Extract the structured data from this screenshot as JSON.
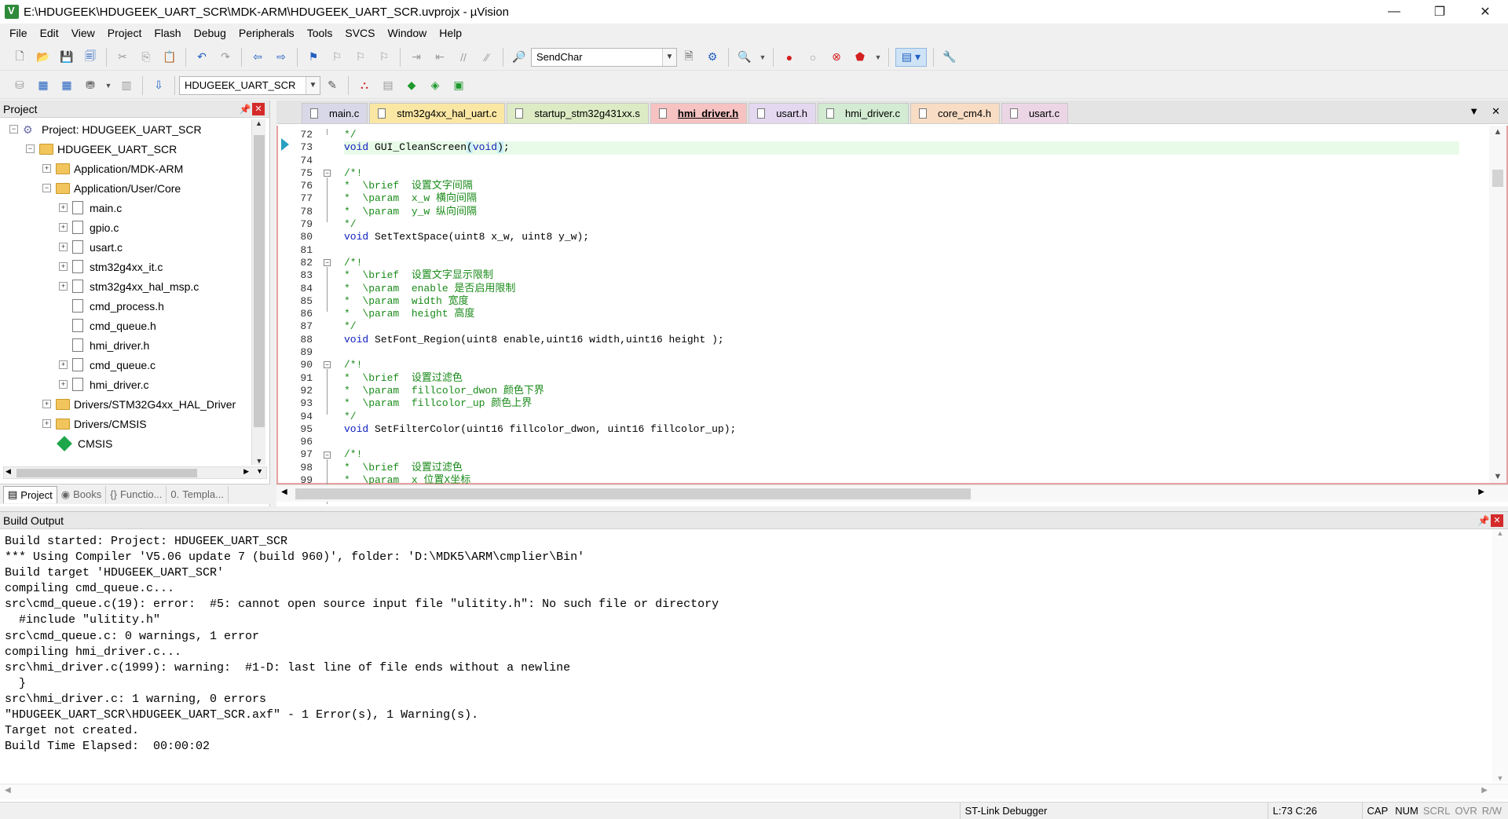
{
  "window": {
    "title": "E:\\HDUGEEK\\HDUGEEK_UART_SCR\\MDK-ARM\\HDUGEEK_UART_SCR.uvprojx - µVision",
    "minimize": "—",
    "restore": "❐",
    "close": "✕"
  },
  "menu": [
    "File",
    "Edit",
    "View",
    "Project",
    "Flash",
    "Debug",
    "Peripherals",
    "Tools",
    "SVCS",
    "Window",
    "Help"
  ],
  "toolbar": {
    "find_combo": "SendChar",
    "target_combo": "HDUGEEK_UART_SCR"
  },
  "project_panel": {
    "title": "Project",
    "tree": [
      {
        "label": "Project: HDUGEEK_UART_SCR",
        "depth": 0,
        "kind": "project",
        "expander": "−"
      },
      {
        "label": "HDUGEEK_UART_SCR",
        "depth": 1,
        "kind": "target",
        "expander": "−"
      },
      {
        "label": "Application/MDK-ARM",
        "depth": 2,
        "kind": "folder",
        "expander": "+"
      },
      {
        "label": "Application/User/Core",
        "depth": 2,
        "kind": "folder",
        "expander": "−"
      },
      {
        "label": "main.c",
        "depth": 3,
        "kind": "file",
        "expander": "+"
      },
      {
        "label": "gpio.c",
        "depth": 3,
        "kind": "file",
        "expander": "+"
      },
      {
        "label": "usart.c",
        "depth": 3,
        "kind": "file",
        "expander": "+"
      },
      {
        "label": "stm32g4xx_it.c",
        "depth": 3,
        "kind": "file",
        "expander": "+"
      },
      {
        "label": "stm32g4xx_hal_msp.c",
        "depth": 3,
        "kind": "file",
        "expander": "+"
      },
      {
        "label": "cmd_process.h",
        "depth": 3,
        "kind": "file",
        "expander": ""
      },
      {
        "label": "cmd_queue.h",
        "depth": 3,
        "kind": "file",
        "expander": ""
      },
      {
        "label": "hmi_driver.h",
        "depth": 3,
        "kind": "file",
        "expander": ""
      },
      {
        "label": "cmd_queue.c",
        "depth": 3,
        "kind": "file",
        "expander": "+"
      },
      {
        "label": "hmi_driver.c",
        "depth": 3,
        "kind": "file",
        "expander": "+"
      },
      {
        "label": "Drivers/STM32G4xx_HAL_Driver",
        "depth": 2,
        "kind": "folder",
        "expander": "+"
      },
      {
        "label": "Drivers/CMSIS",
        "depth": 2,
        "kind": "folder",
        "expander": "+"
      },
      {
        "label": "CMSIS",
        "depth": 2,
        "kind": "component",
        "expander": ""
      }
    ],
    "tabs": [
      {
        "label": "Project",
        "icon": "project-icon"
      },
      {
        "label": "Books",
        "icon": "books-icon"
      },
      {
        "label": "Functio...",
        "icon": "braces-icon"
      },
      {
        "label": "Templa...",
        "icon": "template-icon"
      }
    ]
  },
  "editor": {
    "tabs": [
      {
        "label": "main.c",
        "color": "#d8d8e8",
        "active": false
      },
      {
        "label": "stm32g4xx_hal_uart.c",
        "color": "#fbe7a4",
        "active": false
      },
      {
        "label": "startup_stm32g431xx.s",
        "color": "#dcebc4",
        "active": false
      },
      {
        "label": "hmi_driver.h",
        "color": "#f6c2c2",
        "active": true
      },
      {
        "label": "usart.h",
        "color": "#e4d8f0",
        "active": false
      },
      {
        "label": "hmi_driver.c",
        "color": "#d2ebd2",
        "active": false
      },
      {
        "label": "core_cm4.h",
        "color": "#f8dcc4",
        "active": false
      },
      {
        "label": "usart.c",
        "color": "#ecd6e6",
        "active": false
      }
    ],
    "tab_menu": "▼",
    "tab_close": "✕",
    "line_numbers": [
      "72",
      "73",
      "74",
      "75",
      "76",
      "77",
      "78",
      "79",
      "80",
      "81",
      "82",
      "83",
      "84",
      "85",
      "86",
      "87",
      "88",
      "89",
      "90",
      "91",
      "92",
      "93",
      "94",
      "95",
      "96",
      "97",
      "98",
      "99"
    ],
    "lines": [
      {
        "segments": [
          {
            "t": "*/",
            "c": "cmt"
          }
        ]
      },
      {
        "hl": true,
        "segments": [
          {
            "t": "void",
            "c": "kw"
          },
          {
            "t": " GUI_CleanScreen",
            "c": ""
          },
          {
            "t": "(",
            "c": "hlp"
          },
          {
            "t": "void",
            "c": "kw"
          },
          {
            "t": ")",
            "c": "hlp"
          },
          {
            "t": ";",
            "c": ""
          }
        ]
      },
      {
        "segments": []
      },
      {
        "segments": [
          {
            "t": "/*!",
            "c": "cmt"
          }
        ]
      },
      {
        "segments": [
          {
            "t": "*  \\brief  设置文字间隔",
            "c": "cmt"
          }
        ]
      },
      {
        "segments": [
          {
            "t": "*  \\param  x_w 横向间隔",
            "c": "cmt"
          }
        ]
      },
      {
        "segments": [
          {
            "t": "*  \\param  y_w 纵向间隔",
            "c": "cmt"
          }
        ]
      },
      {
        "segments": [
          {
            "t": "*/",
            "c": "cmt"
          }
        ]
      },
      {
        "segments": [
          {
            "t": "void",
            "c": "kw"
          },
          {
            "t": " SetTextSpace(uint8 x_w, uint8 y_w);",
            "c": ""
          }
        ]
      },
      {
        "segments": []
      },
      {
        "segments": [
          {
            "t": "/*!",
            "c": "cmt"
          }
        ]
      },
      {
        "segments": [
          {
            "t": "*  \\brief  设置文字显示限制",
            "c": "cmt"
          }
        ]
      },
      {
        "segments": [
          {
            "t": "*  \\param  enable 是否启用限制",
            "c": "cmt"
          }
        ]
      },
      {
        "segments": [
          {
            "t": "*  \\param  width 宽度",
            "c": "cmt"
          }
        ]
      },
      {
        "segments": [
          {
            "t": "*  \\param  height 高度",
            "c": "cmt"
          }
        ]
      },
      {
        "segments": [
          {
            "t": "*/",
            "c": "cmt"
          }
        ]
      },
      {
        "segments": [
          {
            "t": "void",
            "c": "kw"
          },
          {
            "t": " SetFont_Region(uint8 enable,uint16 width,uint16 height );",
            "c": ""
          }
        ]
      },
      {
        "segments": []
      },
      {
        "segments": [
          {
            "t": "/*!",
            "c": "cmt"
          }
        ]
      },
      {
        "segments": [
          {
            "t": "*  \\brief  设置过滤色",
            "c": "cmt"
          }
        ]
      },
      {
        "segments": [
          {
            "t": "*  \\param  fillcolor_dwon 颜色下界",
            "c": "cmt"
          }
        ]
      },
      {
        "segments": [
          {
            "t": "*  \\param  fillcolor_up 颜色上界",
            "c": "cmt"
          }
        ]
      },
      {
        "segments": [
          {
            "t": "*/",
            "c": "cmt"
          }
        ]
      },
      {
        "segments": [
          {
            "t": "void",
            "c": "kw"
          },
          {
            "t": " SetFilterColor(uint16 fillcolor_dwon, uint16 fillcolor_up);",
            "c": ""
          }
        ]
      },
      {
        "segments": []
      },
      {
        "segments": [
          {
            "t": "/*!",
            "c": "cmt"
          }
        ]
      },
      {
        "segments": [
          {
            "t": "*  \\brief  设置过滤色",
            "c": "cmt"
          }
        ]
      },
      {
        "segments": [
          {
            "t": "*  \\param  x 位置X坐标",
            "c": "cmt"
          }
        ]
      }
    ],
    "fold_markers": [
      "75",
      "82",
      "90",
      "97"
    ]
  },
  "build_output": {
    "title": "Build Output",
    "lines": [
      "Build started: Project: HDUGEEK_UART_SCR",
      "*** Using Compiler 'V5.06 update 7 (build 960)', folder: 'D:\\MDK5\\ARM\\cmplier\\Bin'",
      "Build target 'HDUGEEK_UART_SCR'",
      "compiling cmd_queue.c...",
      "src\\cmd_queue.c(19): error:  #5: cannot open source input file \"ulitity.h\": No such file or directory",
      "  #include \"ulitity.h\"",
      "src\\cmd_queue.c: 0 warnings, 1 error",
      "compiling hmi_driver.c...",
      "src\\hmi_driver.c(1999): warning:  #1-D: last line of file ends without a newline",
      "  }",
      "src\\hmi_driver.c: 1 warning, 0 errors",
      "\"HDUGEEK_UART_SCR\\HDUGEEK_UART_SCR.axf\" - 1 Error(s), 1 Warning(s).",
      "Target not created.",
      "Build Time Elapsed:  00:00:02"
    ]
  },
  "statusbar": {
    "debugger": "ST-Link Debugger",
    "position": "L:73 C:26",
    "cap": "CAP",
    "num": "NUM",
    "scrl": "SCRL",
    "ovr": "OVR",
    "rw": "R/W"
  }
}
